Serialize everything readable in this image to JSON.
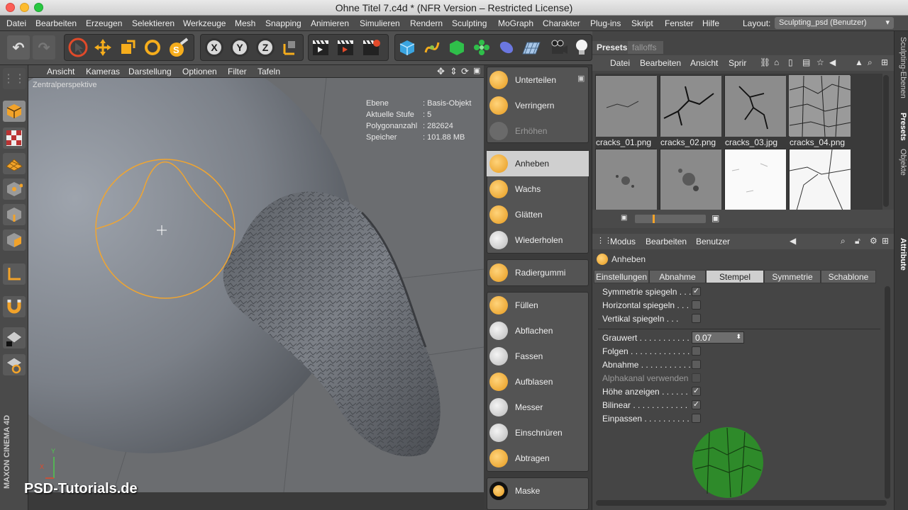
{
  "window": {
    "title": "Ohne Titel 7.c4d * (NFR Version – Restricted License)"
  },
  "menubar": {
    "items": [
      "Datei",
      "Bearbeiten",
      "Erzeugen",
      "Selektieren",
      "Werkzeuge",
      "Mesh",
      "Snapping",
      "Animieren",
      "Simulieren",
      "Rendern",
      "Sculpting",
      "MoGraph",
      "Charakter",
      "Plug-ins",
      "Skript",
      "Fenster",
      "Hilfe"
    ],
    "layout_label": "Layout:",
    "layout_value": "Sculpting_psd (Benutzer)"
  },
  "toolbar": {
    "axis_x": "X",
    "axis_y": "Y",
    "axis_z": "Z"
  },
  "viewport": {
    "menu": [
      "Ansicht",
      "Kameras",
      "Darstellung",
      "Optionen",
      "Filter",
      "Tafeln"
    ],
    "label": "Zentralperspektive",
    "info": [
      {
        "key": "Ebene",
        "value": ": Basis-Objekt"
      },
      {
        "key": "Aktuelle Stufe",
        "value": ": 5"
      },
      {
        "key": "Polygonanzahl",
        "value": ": 282624"
      },
      {
        "key": "Speicher",
        "value": ": 101.88 MB"
      }
    ],
    "watermark": "PSD-Tutorials.de",
    "brand": "MAXON CINEMA 4D",
    "axis_y": "Y",
    "axis_x": "X",
    "brush_color": "#f0a531"
  },
  "brushes": {
    "group1": [
      "Unterteilen",
      "Verringern",
      "Erhöhen"
    ],
    "group2": [
      "Anheben",
      "Wachs",
      "Glätten",
      "Wiederholen"
    ],
    "group3": [
      "Radiergummi"
    ],
    "group4": [
      "Füllen",
      "Abflachen",
      "Fassen",
      "Aufblasen",
      "Messer",
      "Einschnüren",
      "Abtragen"
    ],
    "group5": [
      "Maske"
    ],
    "active": "Anheben"
  },
  "presets": {
    "tabs": [
      "Presets",
      "falloffs"
    ],
    "menu": [
      "Datei",
      "Bearbeiten",
      "Ansicht",
      "Sprir"
    ],
    "thumbs": [
      "cracks_01.png",
      "cracks_02.png",
      "cracks_03.jpg",
      "cracks_04.png",
      "",
      "",
      "",
      ""
    ]
  },
  "sidetabs": [
    "Sculpting-Ebenen",
    "Presets",
    "Objekte",
    "Attribute"
  ],
  "attributes": {
    "menu": [
      "Modus",
      "Bearbeiten",
      "Benutzer"
    ],
    "title": "Anheben",
    "tabs": [
      "Einstellungen",
      "Abnahme",
      "Stempel",
      "Symmetrie",
      "Schablone"
    ],
    "active_tab": "Stempel",
    "props": [
      {
        "label": "Symmetrie spiegeln . . .",
        "check": "✓"
      },
      {
        "label": "Horizontal spiegeln . . .",
        "check": ""
      },
      {
        "label": "Vertikal spiegeln . . .",
        "check": ""
      },
      {
        "label": "Grauwert . . . . . . . . . . .",
        "value": "0.07"
      },
      {
        "label": "Folgen . . . . . . . . . . . . .",
        "check": ""
      },
      {
        "label": "Abnahme . . . . . . . . . . .",
        "check": ""
      },
      {
        "label": "Alphakanal verwenden",
        "check": ""
      },
      {
        "label": "Höhe anzeigen . . . . . .",
        "check": "✓"
      },
      {
        "label": "Bilinear . . . . . . . . . . . .",
        "check": "✓"
      },
      {
        "label": "Einpassen . . . . . . . . . .",
        "check": ""
      }
    ],
    "stamp_color": "#2e8a2a"
  }
}
